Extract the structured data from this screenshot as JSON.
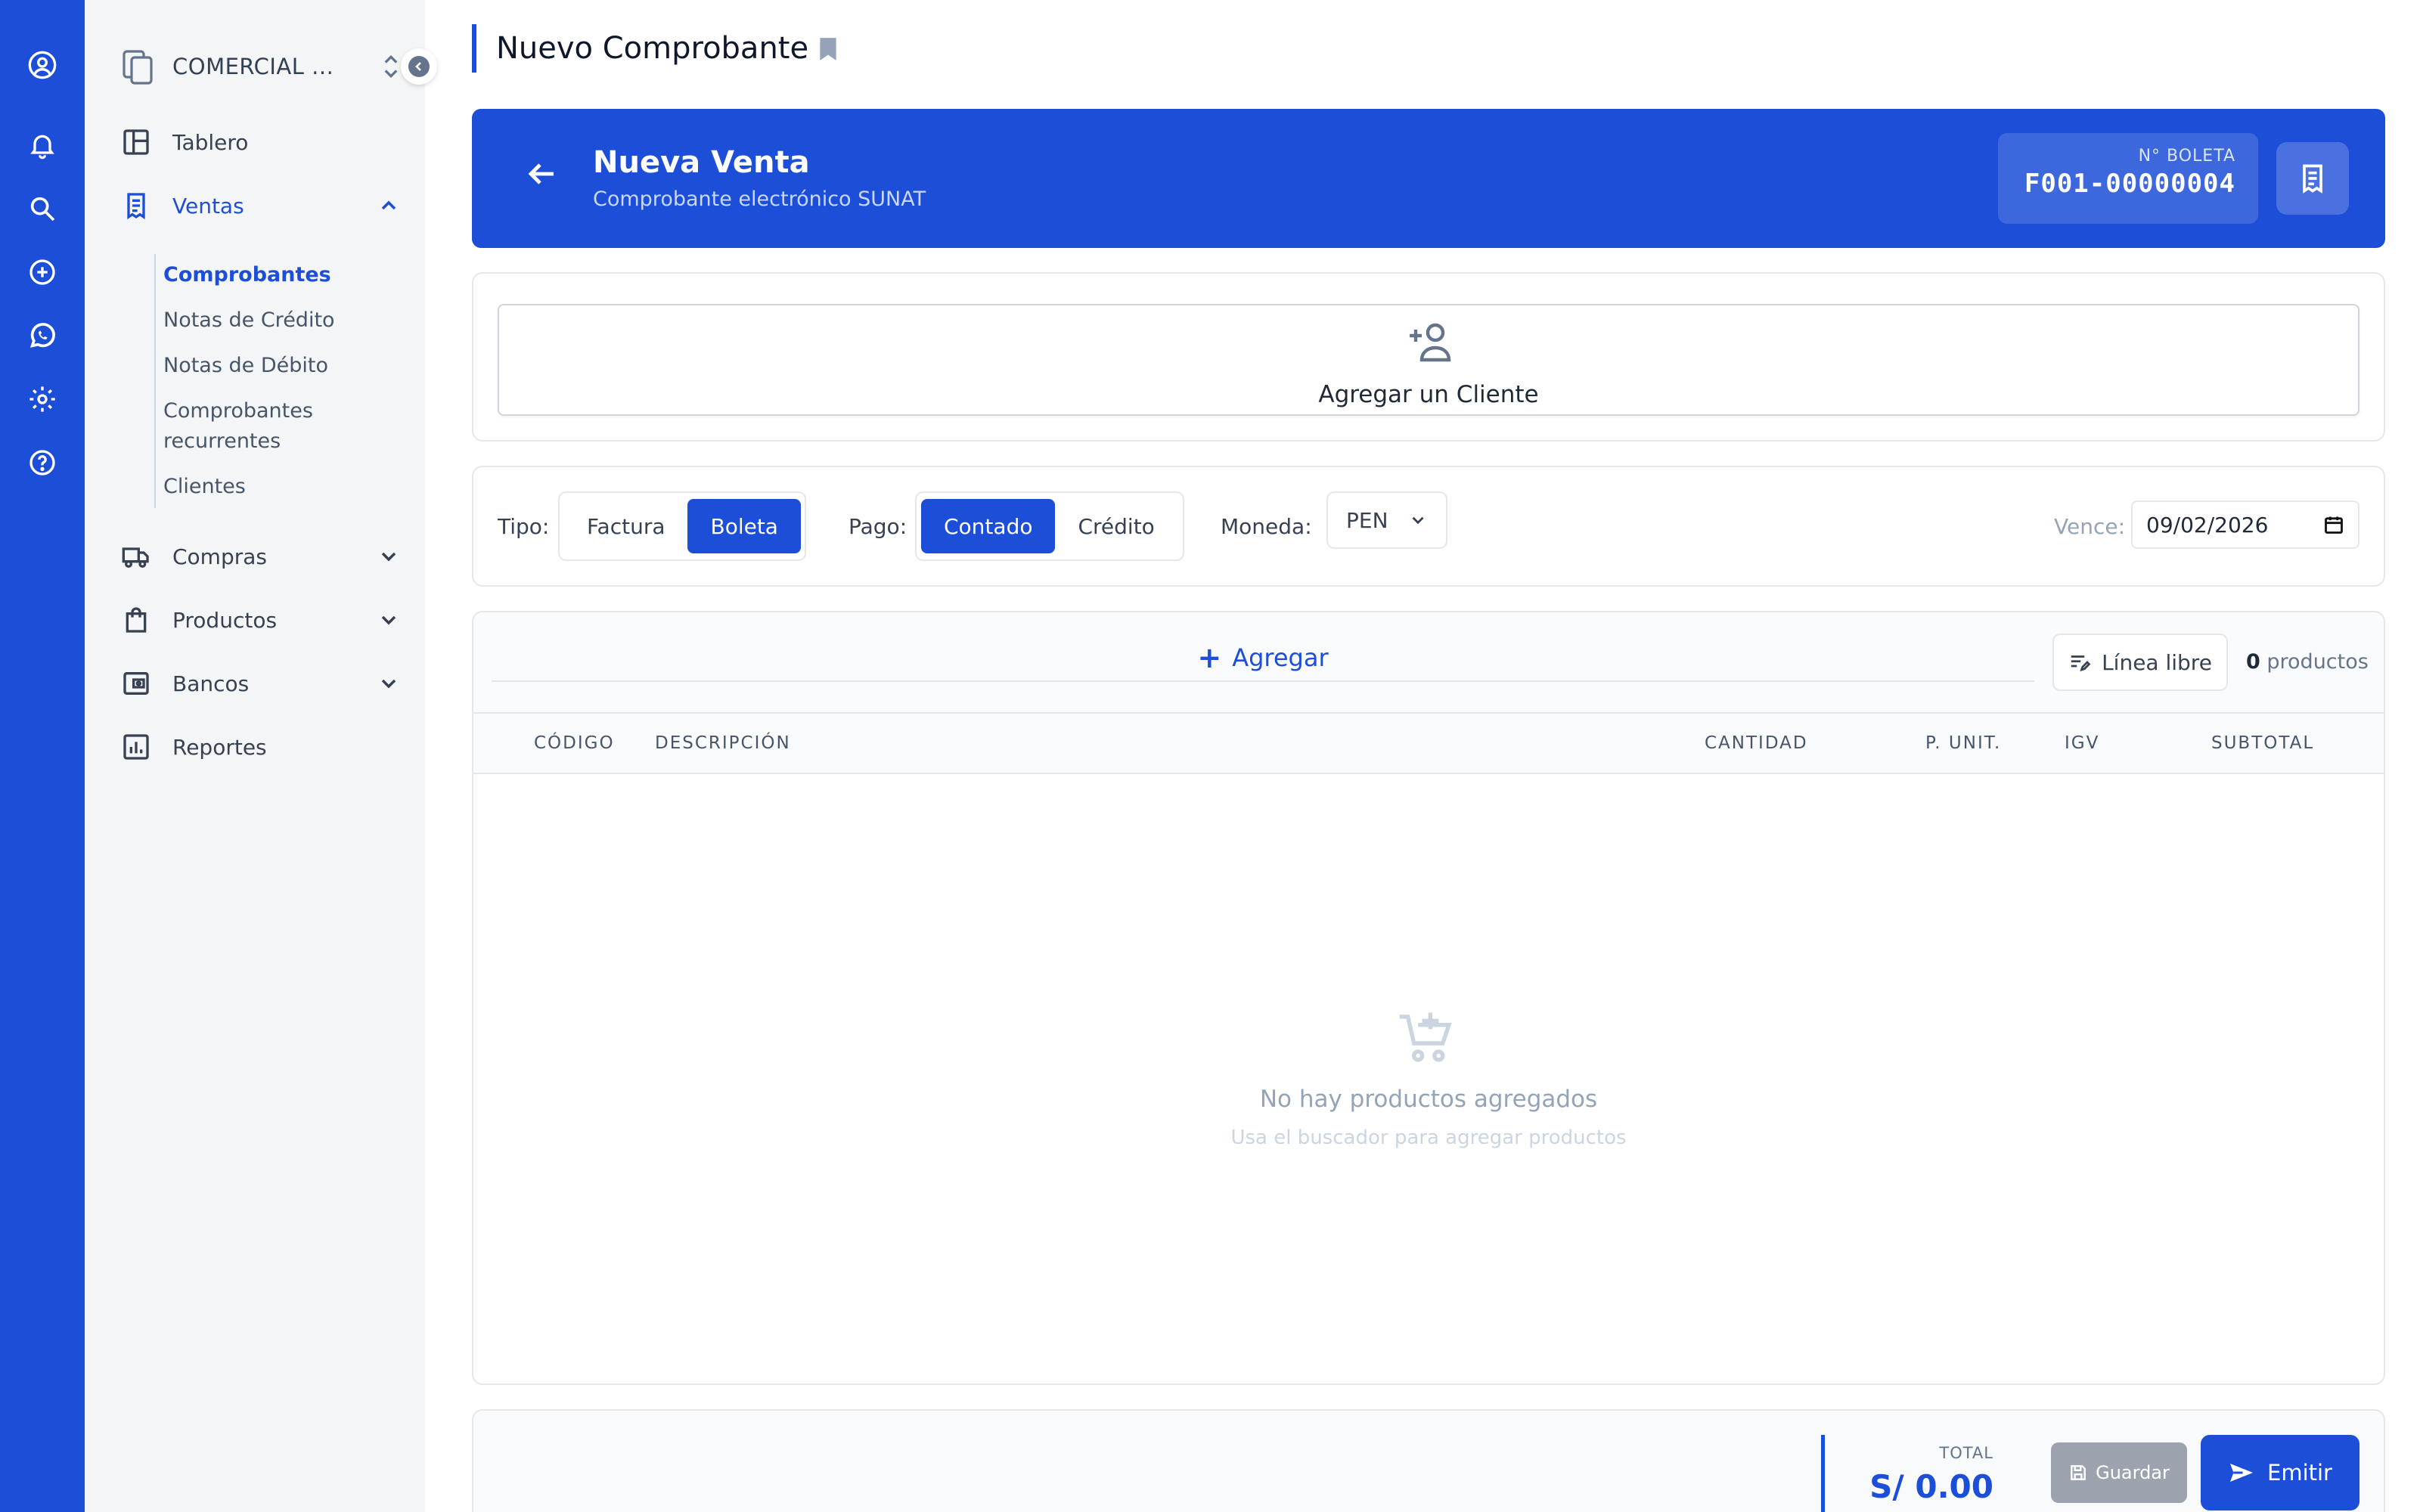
{
  "colors": {
    "primary": "#1d4ed8",
    "sidebar_bg": "#f4f5f7",
    "muted": "#94a3b8"
  },
  "rail": {
    "icons": [
      "user-circle-icon",
      "bell-icon",
      "search-icon",
      "plus-circle-icon",
      "whatsapp-icon",
      "gear-icon",
      "help-circle-icon"
    ]
  },
  "sidebar": {
    "company_name": "COMERCIAL ...",
    "items": [
      {
        "label": "Tablero",
        "icon": "dashboard-icon"
      },
      {
        "label": "Ventas",
        "icon": "receipt-icon"
      },
      {
        "label": "Compras",
        "icon": "truck-icon"
      },
      {
        "label": "Productos",
        "icon": "shopping-bag-icon"
      },
      {
        "label": "Bancos",
        "icon": "wallet-icon"
      },
      {
        "label": "Reportes",
        "icon": "bar-chart-icon"
      }
    ],
    "ventas_sub": [
      {
        "label": "Comprobantes"
      },
      {
        "label": "Notas de Crédito"
      },
      {
        "label": "Notas de Débito"
      },
      {
        "label": "Comprobantes recurrentes"
      },
      {
        "label": "Clientes"
      }
    ]
  },
  "header": {
    "title": "Nuevo Comprobante"
  },
  "hero": {
    "title": "Nueva Venta",
    "subtitle": "Comprobante electrónico SUNAT",
    "doc_label": "N° BOLETA",
    "doc_number": "F001-00000004"
  },
  "client": {
    "add_label": "Agregar un Cliente"
  },
  "options": {
    "tipo_label": "Tipo:",
    "tipo_options": [
      "Factura",
      "Boleta"
    ],
    "tipo_selected": "Boleta",
    "pago_label": "Pago:",
    "pago_options": [
      "Contado",
      "Crédito"
    ],
    "pago_selected": "Contado",
    "moneda_label": "Moneda:",
    "moneda_value": "PEN",
    "vence_label": "Vence:",
    "vence_value": "09/02/2026"
  },
  "items": {
    "add_label": "Agregar",
    "free_line_label": "Línea libre",
    "count_value": "0",
    "count_label": "productos",
    "columns": [
      "CÓDIGO",
      "DESCRIPCIÓN",
      "CANTIDAD",
      "P. UNIT.",
      "IGV",
      "SUBTOTAL"
    ],
    "rows": [],
    "empty_title": "No hay productos agregados",
    "empty_subtitle": "Usa el buscador para agregar productos"
  },
  "footer": {
    "total_label": "TOTAL",
    "total_value": "S/ 0.00",
    "save_label": "Guardar",
    "emit_label": "Emitir"
  }
}
